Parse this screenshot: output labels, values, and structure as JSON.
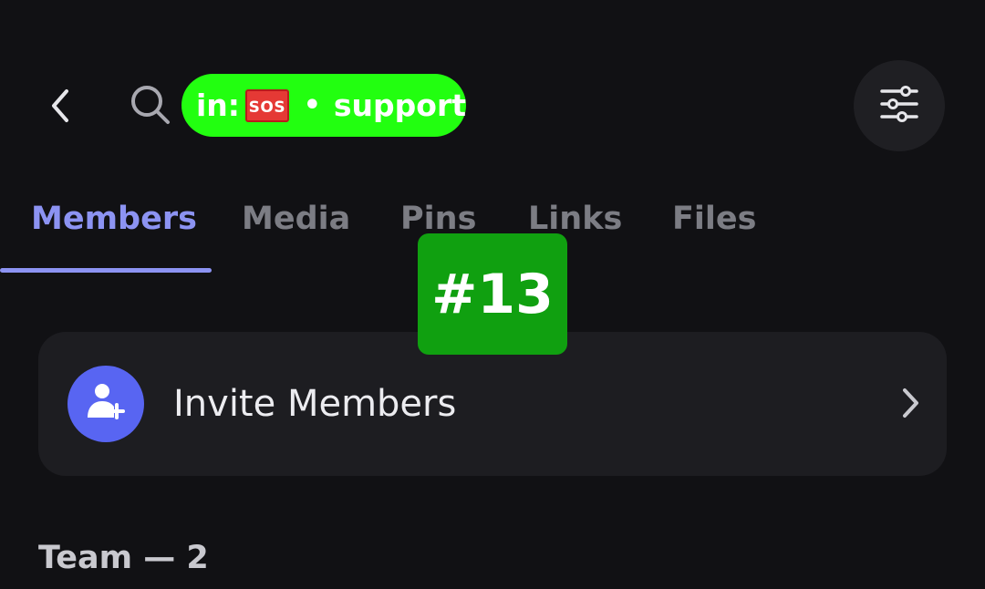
{
  "header": {
    "back_icon": "chevron-left-icon",
    "search_icon": "search-icon",
    "filter_icon": "sliders-icon",
    "chip": {
      "prefix": "in:",
      "emoji_text": "SOS",
      "separator": "•",
      "channel": "support",
      "color": "#22ff10"
    }
  },
  "tabs": [
    {
      "label": "Members",
      "active": true
    },
    {
      "label": "Media",
      "active": false
    },
    {
      "label": "Pins",
      "active": false
    },
    {
      "label": "Links",
      "active": false
    },
    {
      "label": "Files",
      "active": false
    }
  ],
  "invite": {
    "label": "Invite Members",
    "icon": "add-person-icon",
    "chevron_icon": "chevron-right-icon"
  },
  "badge": {
    "label": "#13"
  },
  "section": {
    "title": "Team — 2"
  },
  "colors": {
    "background": "#111114",
    "accent": "#8c93f2",
    "invite_avatar": "#5865f2",
    "badge": "#10a010"
  }
}
